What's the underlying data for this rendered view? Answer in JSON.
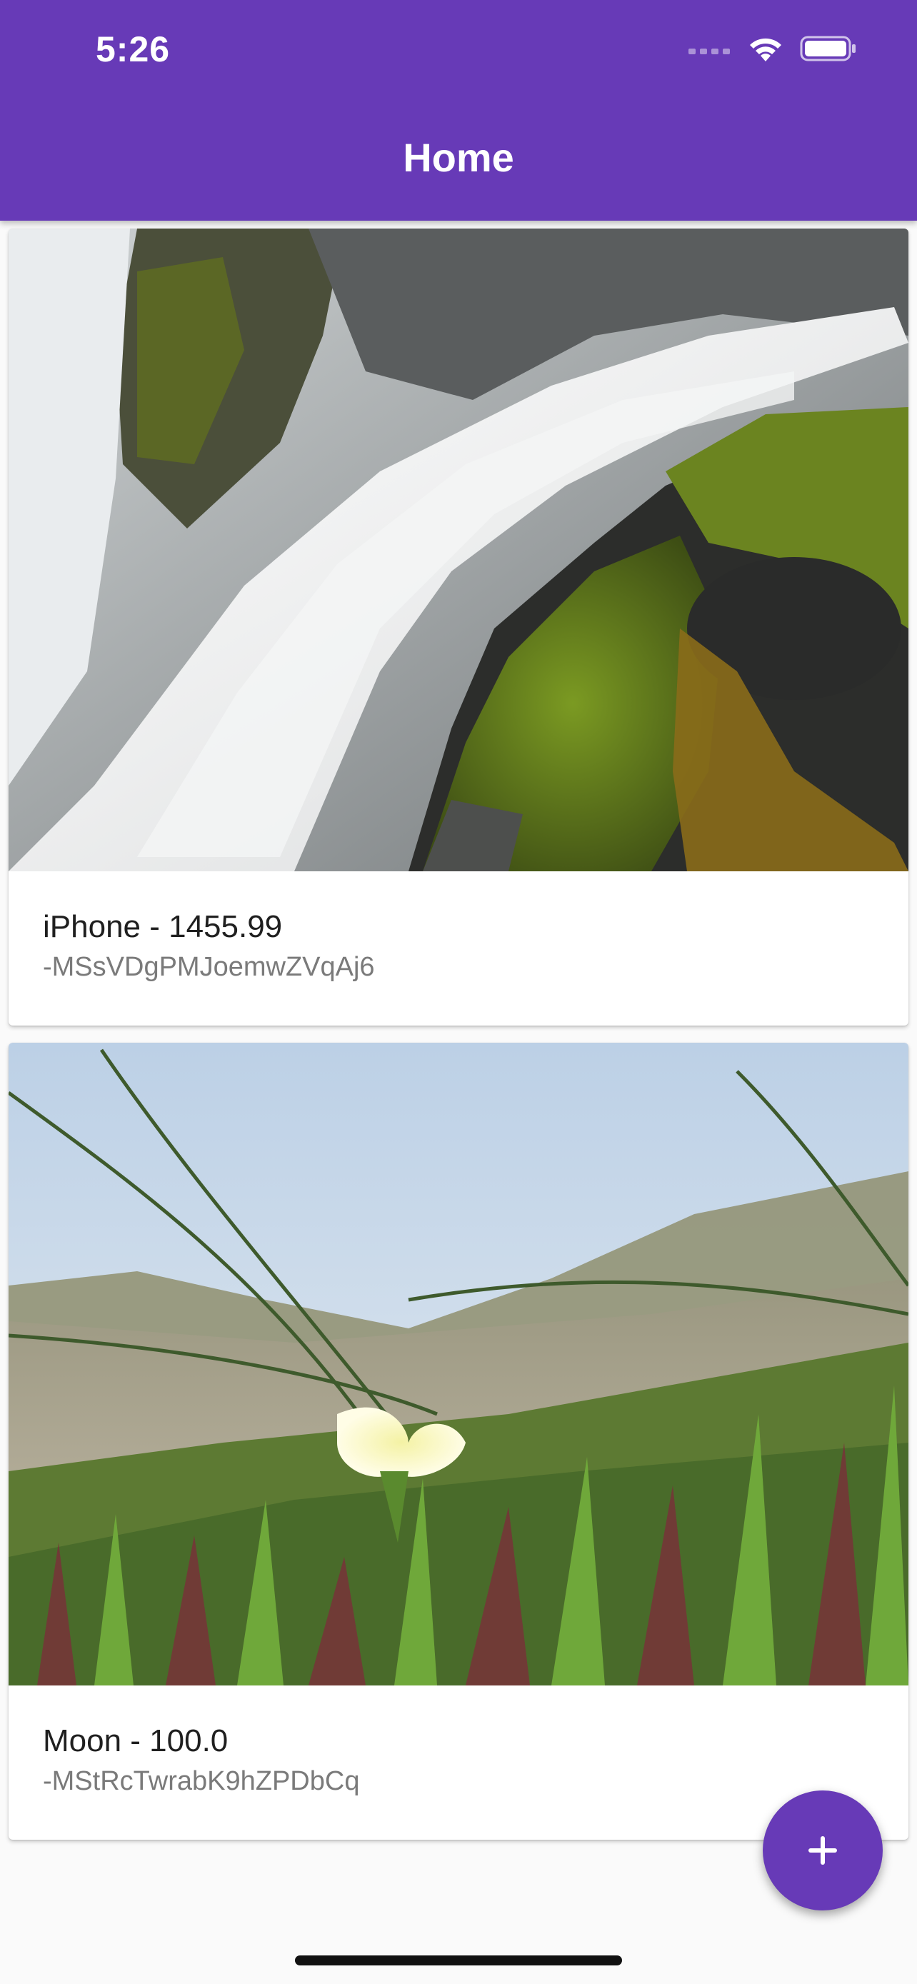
{
  "status_bar": {
    "time": "5:26"
  },
  "app_bar": {
    "title": "Home"
  },
  "products": [
    {
      "title": "iPhone - 1455.99",
      "id": "-MSsVDgPMJoemwZVqAj6",
      "image": "waterfall-over-mossy-rocks"
    },
    {
      "title": "Moon - 100.0",
      "id": "-MStRcTwrabK9hZPDbCq",
      "image": "yellow-flower-in-succulents-at-beach"
    }
  ],
  "fab": {
    "icon": "plus-icon"
  },
  "colors": {
    "primary": "#673ab7",
    "background": "#fafafa"
  }
}
